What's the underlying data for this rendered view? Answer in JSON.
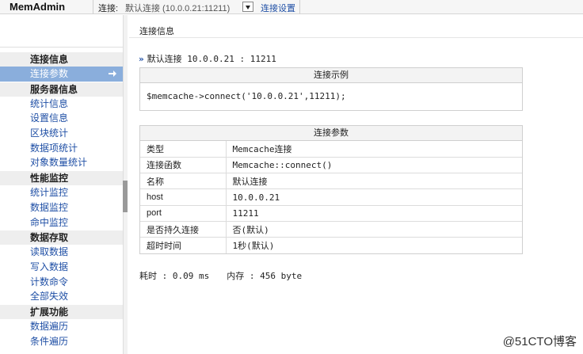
{
  "topbar": {
    "app_title": "MemAdmin",
    "conn_label": "连接:",
    "conn_value": "默认连接 (10.0.0.21:11211)",
    "conn_settings": "连接设置"
  },
  "sidebar": {
    "sections": [
      {
        "header": "连接信息",
        "items": [
          "连接参数"
        ]
      },
      {
        "header": "服务器信息",
        "items": [
          "统计信息",
          "设置信息",
          "区块统计",
          "数据项统计",
          "对象数量统计"
        ]
      },
      {
        "header": "性能监控",
        "items": [
          "统计监控",
          "数据监控",
          "命中监控"
        ]
      },
      {
        "header": "数据存取",
        "items": [
          "读取数据",
          "写入数据",
          "计数命令",
          "全部失效"
        ]
      },
      {
        "header": "扩展功能",
        "items": [
          "数据遍历",
          "条件遍历"
        ]
      }
    ],
    "active_item": "连接参数"
  },
  "main": {
    "page_title": "连接信息",
    "default_conn": "默认连接 10.0.0.21 : 11211",
    "example_box": {
      "title": "连接示例",
      "code": "$memcache->connect('10.0.0.21',11211);"
    },
    "params_box": {
      "title": "连接参数",
      "rows": [
        {
          "k": "类型",
          "v": "Memcache连接"
        },
        {
          "k": "连接函数",
          "v": "Memcache::connect()"
        },
        {
          "k": "名称",
          "v": "默认连接"
        },
        {
          "k": "host",
          "v": "10.0.0.21"
        },
        {
          "k": "port",
          "v": "11211"
        },
        {
          "k": "是否持久连接",
          "v": "否(默认)"
        },
        {
          "k": "超时时间",
          "v": "1秒(默认)"
        }
      ]
    },
    "stats": {
      "time": "耗时 : 0.09 ms",
      "memory": "内存 : 456 byte"
    }
  },
  "watermark": "@51CTO博客",
  "colors": {
    "link": "#1f4fa5",
    "active_bg": "#8aaedc",
    "header_bg": "#eeeeee"
  }
}
